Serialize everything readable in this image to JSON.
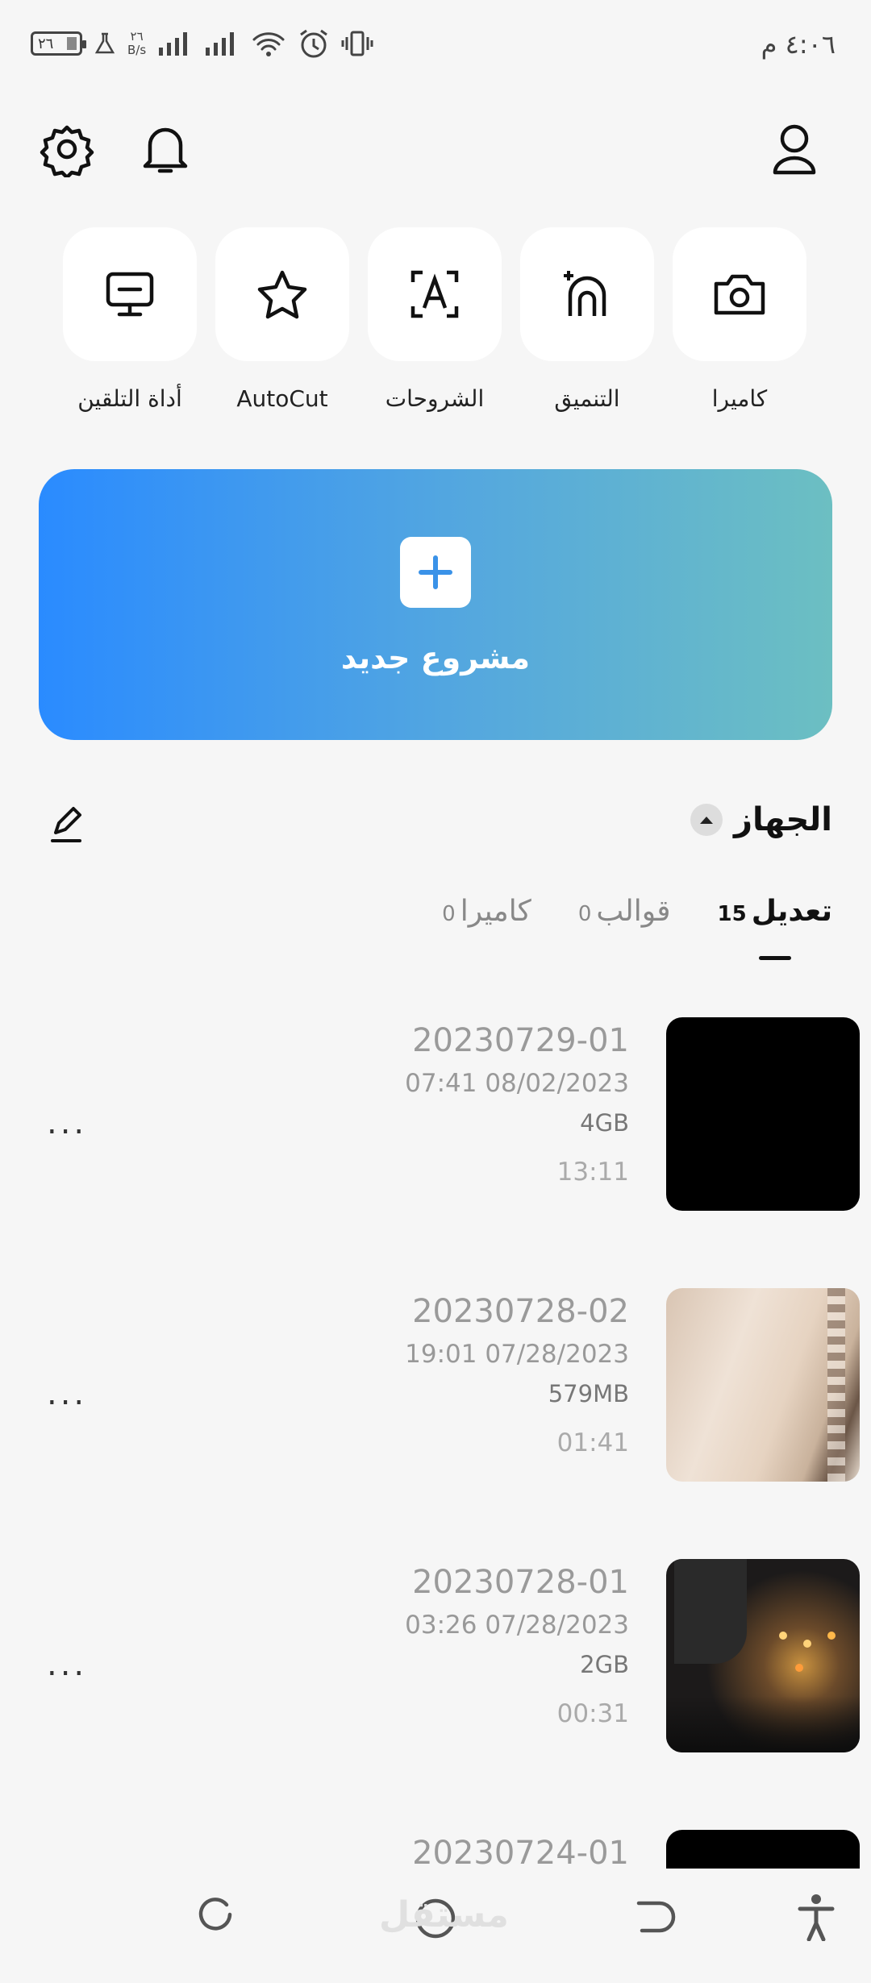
{
  "status_bar": {
    "battery": "٢٦",
    "speed_value": "٢٦",
    "speed_unit": "B/s",
    "time": "٤:٠٦ م"
  },
  "header": {
    "icons": [
      "settings-icon",
      "bell-icon",
      "profile-icon"
    ]
  },
  "tools": [
    {
      "label": "كاميرا",
      "icon": "camera-icon"
    },
    {
      "label": "التنميق",
      "icon": "retouch-icon"
    },
    {
      "label": "الشروحات",
      "icon": "captions-icon"
    },
    {
      "label": "AutoCut",
      "icon": "autocut-icon"
    },
    {
      "label": "أداة التلقين",
      "icon": "teleprompter-icon"
    }
  ],
  "hero": {
    "label": "مشروع جديد"
  },
  "section": {
    "title": "الجهاز"
  },
  "tabs": [
    {
      "label": "تعديل",
      "count": "15",
      "active": true
    },
    {
      "label": "قوالب",
      "count": "0",
      "active": false
    },
    {
      "label": "كاميرا",
      "count": "0",
      "active": false
    }
  ],
  "projects": [
    {
      "name": "20230729-01",
      "date": "07:41 08/02/2023",
      "size": "4GB",
      "duration": "13:11",
      "more": "...",
      "thumb": "black"
    },
    {
      "name": "20230728-02",
      "date": "19:01 07/28/2023",
      "size": "579MB",
      "duration": "01:41",
      "more": "...",
      "thumb": "fabric"
    },
    {
      "name": "20230728-01",
      "date": "03:26 07/28/2023",
      "size": "2GB",
      "duration": "00:31",
      "more": "...",
      "thumb": "crowd"
    },
    {
      "name": "20230724-01",
      "date": "",
      "size": "",
      "duration": "",
      "more": "",
      "thumb": "black"
    }
  ],
  "watermark": "مستقل"
}
